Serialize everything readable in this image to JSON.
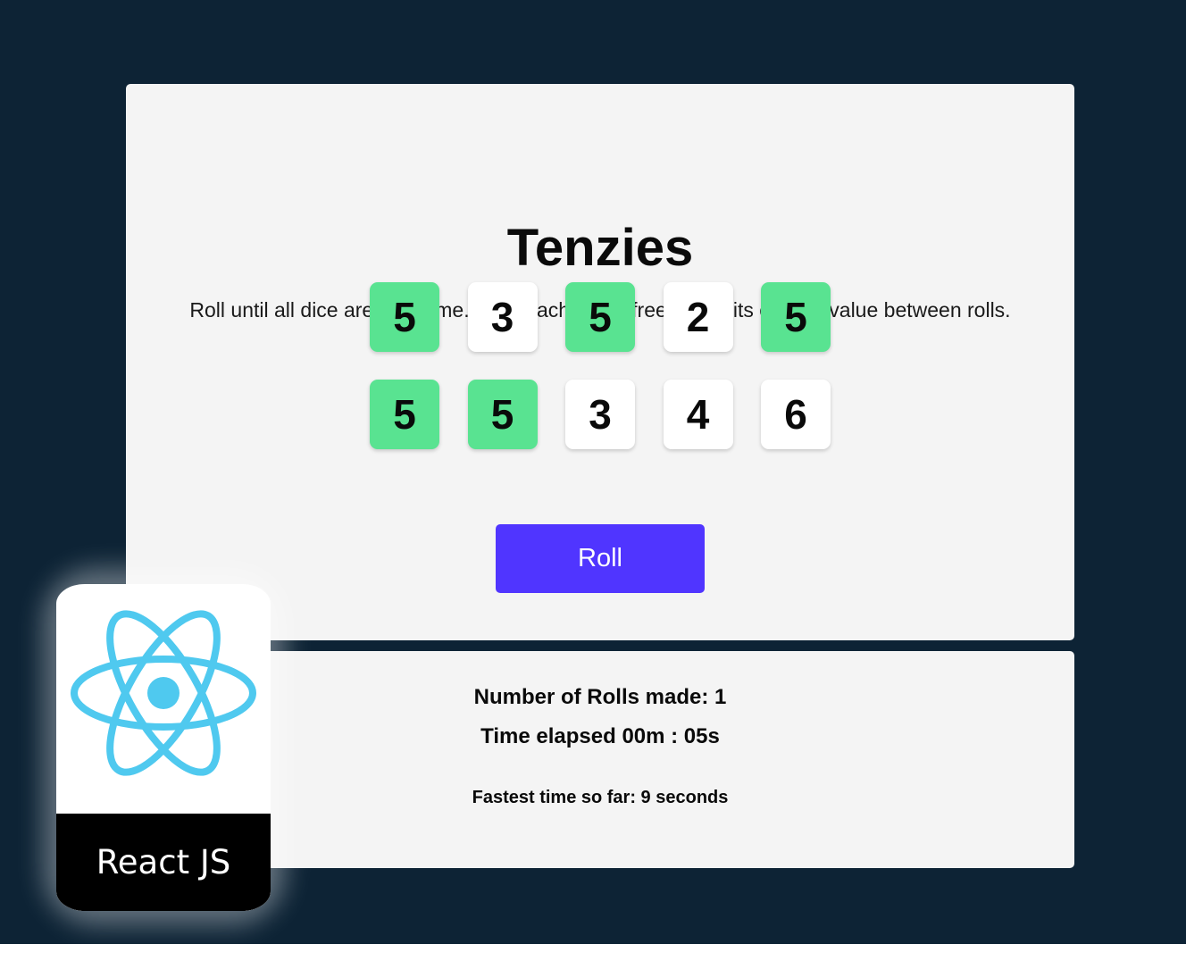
{
  "app": {
    "title": "Tenzies",
    "instructions": "Roll until all dice are the same. Click each die to freeze it at its current value between rolls."
  },
  "dice": [
    {
      "value": "5",
      "held": true
    },
    {
      "value": "3",
      "held": false
    },
    {
      "value": "5",
      "held": true
    },
    {
      "value": "2",
      "held": false
    },
    {
      "value": "5",
      "held": true
    },
    {
      "value": "5",
      "held": true
    },
    {
      "value": "5",
      "held": true
    },
    {
      "value": "3",
      "held": false
    },
    {
      "value": "4",
      "held": false
    },
    {
      "value": "6",
      "held": false
    }
  ],
  "roll_button": {
    "label": "Roll"
  },
  "stats": {
    "rolls": "Number of Rolls made: 1",
    "time": "Time elapsed 00m : 05s",
    "best": "Fastest time so far: 9 seconds"
  },
  "badge": {
    "label": "React JS",
    "icon": "react-atom-icon"
  },
  "colors": {
    "background": "#0d2335",
    "panel": "#f4f4f4",
    "held_die": "#59e391",
    "free_die": "#ffffff",
    "roll_button": "#5035ff",
    "react_blue": "#4fc9ef"
  }
}
